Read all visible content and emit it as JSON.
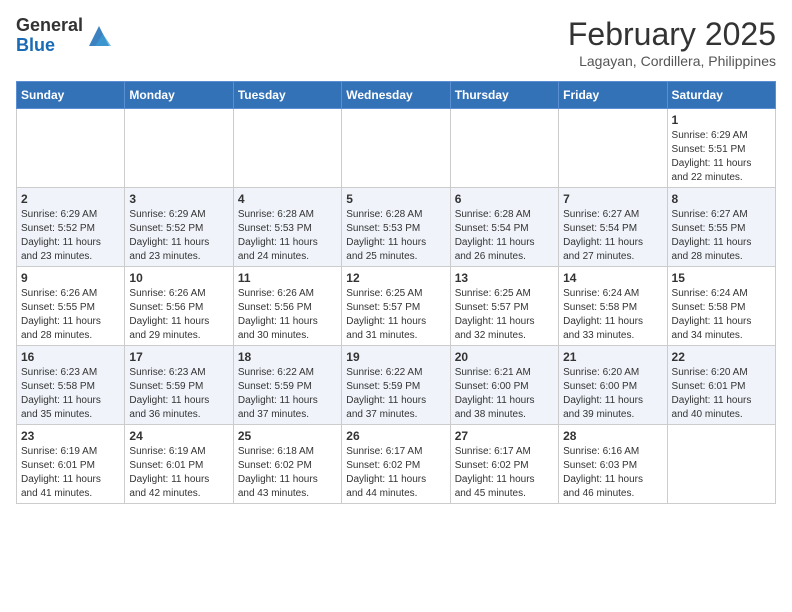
{
  "header": {
    "logo_general": "General",
    "logo_blue": "Blue",
    "month_year": "February 2025",
    "location": "Lagayan, Cordillera, Philippines"
  },
  "weekdays": [
    "Sunday",
    "Monday",
    "Tuesday",
    "Wednesday",
    "Thursday",
    "Friday",
    "Saturday"
  ],
  "weeks": [
    [
      {
        "day": "",
        "info": ""
      },
      {
        "day": "",
        "info": ""
      },
      {
        "day": "",
        "info": ""
      },
      {
        "day": "",
        "info": ""
      },
      {
        "day": "",
        "info": ""
      },
      {
        "day": "",
        "info": ""
      },
      {
        "day": "1",
        "info": "Sunrise: 6:29 AM\nSunset: 5:51 PM\nDaylight: 11 hours\nand 22 minutes."
      }
    ],
    [
      {
        "day": "2",
        "info": "Sunrise: 6:29 AM\nSunset: 5:52 PM\nDaylight: 11 hours\nand 23 minutes."
      },
      {
        "day": "3",
        "info": "Sunrise: 6:29 AM\nSunset: 5:52 PM\nDaylight: 11 hours\nand 23 minutes."
      },
      {
        "day": "4",
        "info": "Sunrise: 6:28 AM\nSunset: 5:53 PM\nDaylight: 11 hours\nand 24 minutes."
      },
      {
        "day": "5",
        "info": "Sunrise: 6:28 AM\nSunset: 5:53 PM\nDaylight: 11 hours\nand 25 minutes."
      },
      {
        "day": "6",
        "info": "Sunrise: 6:28 AM\nSunset: 5:54 PM\nDaylight: 11 hours\nand 26 minutes."
      },
      {
        "day": "7",
        "info": "Sunrise: 6:27 AM\nSunset: 5:54 PM\nDaylight: 11 hours\nand 27 minutes."
      },
      {
        "day": "8",
        "info": "Sunrise: 6:27 AM\nSunset: 5:55 PM\nDaylight: 11 hours\nand 28 minutes."
      }
    ],
    [
      {
        "day": "9",
        "info": "Sunrise: 6:26 AM\nSunset: 5:55 PM\nDaylight: 11 hours\nand 28 minutes."
      },
      {
        "day": "10",
        "info": "Sunrise: 6:26 AM\nSunset: 5:56 PM\nDaylight: 11 hours\nand 29 minutes."
      },
      {
        "day": "11",
        "info": "Sunrise: 6:26 AM\nSunset: 5:56 PM\nDaylight: 11 hours\nand 30 minutes."
      },
      {
        "day": "12",
        "info": "Sunrise: 6:25 AM\nSunset: 5:57 PM\nDaylight: 11 hours\nand 31 minutes."
      },
      {
        "day": "13",
        "info": "Sunrise: 6:25 AM\nSunset: 5:57 PM\nDaylight: 11 hours\nand 32 minutes."
      },
      {
        "day": "14",
        "info": "Sunrise: 6:24 AM\nSunset: 5:58 PM\nDaylight: 11 hours\nand 33 minutes."
      },
      {
        "day": "15",
        "info": "Sunrise: 6:24 AM\nSunset: 5:58 PM\nDaylight: 11 hours\nand 34 minutes."
      }
    ],
    [
      {
        "day": "16",
        "info": "Sunrise: 6:23 AM\nSunset: 5:58 PM\nDaylight: 11 hours\nand 35 minutes."
      },
      {
        "day": "17",
        "info": "Sunrise: 6:23 AM\nSunset: 5:59 PM\nDaylight: 11 hours\nand 36 minutes."
      },
      {
        "day": "18",
        "info": "Sunrise: 6:22 AM\nSunset: 5:59 PM\nDaylight: 11 hours\nand 37 minutes."
      },
      {
        "day": "19",
        "info": "Sunrise: 6:22 AM\nSunset: 5:59 PM\nDaylight: 11 hours\nand 37 minutes."
      },
      {
        "day": "20",
        "info": "Sunrise: 6:21 AM\nSunset: 6:00 PM\nDaylight: 11 hours\nand 38 minutes."
      },
      {
        "day": "21",
        "info": "Sunrise: 6:20 AM\nSunset: 6:00 PM\nDaylight: 11 hours\nand 39 minutes."
      },
      {
        "day": "22",
        "info": "Sunrise: 6:20 AM\nSunset: 6:01 PM\nDaylight: 11 hours\nand 40 minutes."
      }
    ],
    [
      {
        "day": "23",
        "info": "Sunrise: 6:19 AM\nSunset: 6:01 PM\nDaylight: 11 hours\nand 41 minutes."
      },
      {
        "day": "24",
        "info": "Sunrise: 6:19 AM\nSunset: 6:01 PM\nDaylight: 11 hours\nand 42 minutes."
      },
      {
        "day": "25",
        "info": "Sunrise: 6:18 AM\nSunset: 6:02 PM\nDaylight: 11 hours\nand 43 minutes."
      },
      {
        "day": "26",
        "info": "Sunrise: 6:17 AM\nSunset: 6:02 PM\nDaylight: 11 hours\nand 44 minutes."
      },
      {
        "day": "27",
        "info": "Sunrise: 6:17 AM\nSunset: 6:02 PM\nDaylight: 11 hours\nand 45 minutes."
      },
      {
        "day": "28",
        "info": "Sunrise: 6:16 AM\nSunset: 6:03 PM\nDaylight: 11 hours\nand 46 minutes."
      },
      {
        "day": "",
        "info": ""
      }
    ]
  ],
  "alt_rows": [
    1,
    3
  ]
}
